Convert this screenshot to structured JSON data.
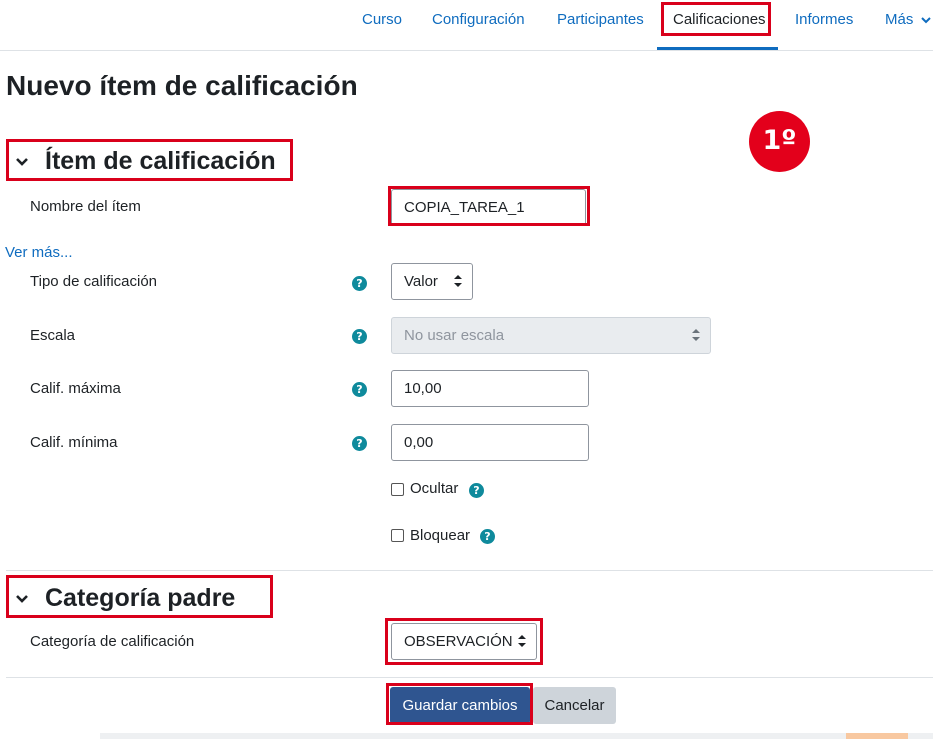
{
  "nav": {
    "items": [
      {
        "label": "Curso"
      },
      {
        "label": "Configuración"
      },
      {
        "label": "Participantes"
      },
      {
        "label": "Calificaciones"
      },
      {
        "label": "Informes"
      },
      {
        "label": "Más"
      }
    ],
    "active": "Calificaciones"
  },
  "page": {
    "title": "Nuevo ítem de calificación",
    "step_badge": "1º"
  },
  "section_item": {
    "heading": "Ítem de calificación",
    "name_label": "Nombre del ítem",
    "name_value": "COPIA_TAREA_1",
    "show_more": "Ver más...",
    "grade_type_label": "Tipo de calificación",
    "grade_type_value": "Valor",
    "scale_label": "Escala",
    "scale_value": "No usar escala",
    "max_label": "Calif. máxima",
    "max_value": "10,00",
    "min_label": "Calif. mínima",
    "min_value": "0,00",
    "hide_label": "Ocultar",
    "lock_label": "Bloquear"
  },
  "section_parent": {
    "heading": "Categoría padre",
    "category_label": "Categoría de calificación",
    "category_value": "OBSERVACIÓN"
  },
  "actions": {
    "save": "Guardar cambios",
    "cancel": "Cancelar"
  },
  "colors": {
    "highlight": "#d9001b",
    "link": "#0f6cbf",
    "help": "#0f8a9c",
    "primary_button": "#2f5590"
  }
}
